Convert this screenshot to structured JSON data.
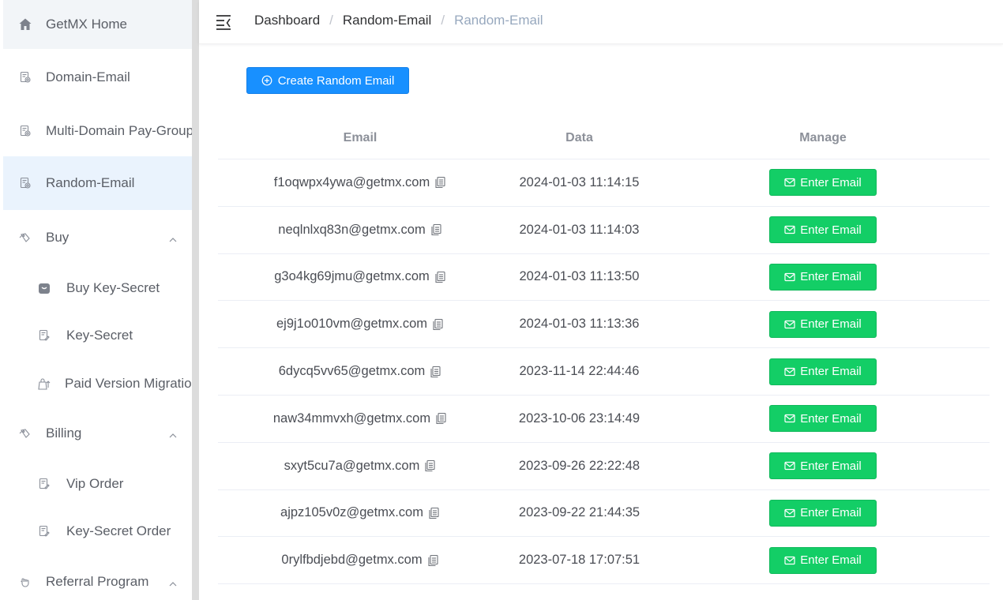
{
  "sidebar": {
    "home": "GetMX Home",
    "items": [
      {
        "label": "Domain-Email"
      },
      {
        "label": "Multi-Domain Pay-Group"
      },
      {
        "label": "Random-Email"
      },
      {
        "label": "Buy"
      },
      {
        "label": "Buy Key-Secret"
      },
      {
        "label": "Key-Secret"
      },
      {
        "label": "Paid Version Migration"
      },
      {
        "label": "Billing"
      },
      {
        "label": "Vip Order"
      },
      {
        "label": "Key-Secret Order"
      },
      {
        "label": "Referral Program"
      }
    ]
  },
  "breadcrumb": [
    "Dashboard",
    "Random-Email",
    "Random-Email"
  ],
  "actions": {
    "create_label": "Create Random Email"
  },
  "table": {
    "headers": [
      "Email",
      "Data",
      "Manage"
    ],
    "enter_label": "Enter Email",
    "rows": [
      {
        "email": "f1oqwpx4ywa@getmx.com",
        "date": "2024-01-03 11:14:15"
      },
      {
        "email": "neqlnlxq83n@getmx.com",
        "date": "2024-01-03 11:14:03"
      },
      {
        "email": "g3o4kg69jmu@getmx.com",
        "date": "2024-01-03 11:13:50"
      },
      {
        "email": "ej9j1o010vm@getmx.com",
        "date": "2024-01-03 11:13:36"
      },
      {
        "email": "6dycq5vv65@getmx.com",
        "date": "2023-11-14 22:44:46"
      },
      {
        "email": "naw34mmvxh@getmx.com",
        "date": "2023-10-06 23:14:49"
      },
      {
        "email": "sxyt5cu7a@getmx.com",
        "date": "2023-09-26 22:22:48"
      },
      {
        "email": "ajpz105v0z@getmx.com",
        "date": "2023-09-22 21:44:35"
      },
      {
        "email": "0rylfbdjebd@getmx.com",
        "date": "2023-07-18 17:07:51"
      }
    ]
  },
  "colors": {
    "primary": "#1890ff",
    "success": "#13ce66",
    "active_bg": "#eaf3fd"
  }
}
